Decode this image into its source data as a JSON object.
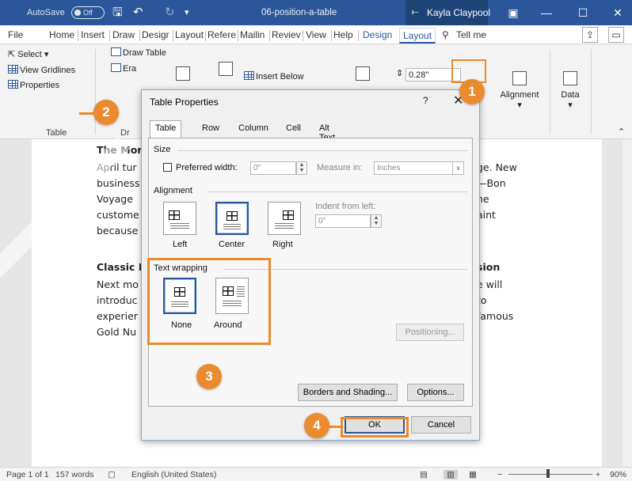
{
  "titlebar": {
    "autosave_label": "AutoSave",
    "autosave_state": "Off",
    "save_icon": "save-icon",
    "undo_icon": "undo-icon",
    "redo_icon": "redo-icon",
    "customize_icon": "customize-icon",
    "filename": "06-position-a-table",
    "user_name": "Kayla Claypool",
    "user_icon_glyph": "⟝",
    "ribbon_display_glyph": "▣",
    "minimize_glyph": "—",
    "maximize_glyph": "☐",
    "close_glyph": "✕"
  },
  "tabs": [
    {
      "label": "File"
    },
    {
      "label": "Home"
    },
    {
      "label": "Insert"
    },
    {
      "label": "Draw"
    },
    {
      "label": "Desigr"
    },
    {
      "label": "Layout"
    },
    {
      "label": "Refere"
    },
    {
      "label": "Mailin"
    },
    {
      "label": "Reviev"
    },
    {
      "label": "View"
    },
    {
      "label": "Help"
    },
    {
      "label": "Design"
    },
    {
      "label": "Layout"
    },
    {
      "label": "Tell me"
    }
  ],
  "ribbon": {
    "select_label": "Select",
    "view_gridlines_label": "View Gridlines",
    "properties_label": "Properties",
    "table_group_label": "Table",
    "draw_table_label": "Draw Table",
    "eraser_label": "Era",
    "draw_group_label": "Dr",
    "insert_below_label": "Insert Below",
    "height_value": "0.28\"",
    "alignment_label": "Alignment",
    "data_label": "Data"
  },
  "document": {
    "lines": [
      {
        "left": "The Mor",
        "right": ""
      },
      {
        "left": "April tur",
        "right": "ge. New"
      },
      {
        "left": "business",
        "right": "—Bon"
      },
      {
        "left": "Voyage",
        "right": "ne"
      },
      {
        "left": "custome",
        "right": "aint"
      },
      {
        "left": "because",
        "right": ""
      },
      {
        "left": "Classic L",
        "right": "sion"
      },
      {
        "left": "Next mo",
        "right": "e will"
      },
      {
        "left": "introduc",
        "right": "to"
      },
      {
        "left": "experier",
        "right": "famous"
      },
      {
        "left": "Gold Nu",
        "right": ""
      }
    ]
  },
  "dialog": {
    "title": "Table Properties",
    "help_glyph": "?",
    "close_glyph": "✕",
    "tabs": [
      "Table",
      "Row",
      "Column",
      "Cell",
      "Alt Text"
    ],
    "size_label": "Size",
    "preferred_width_label": "Preferred width:",
    "preferred_width_value": "0\"",
    "measure_in_label": "Measure in:",
    "measure_in_value": "Inches",
    "alignment_label": "Alignment",
    "align_left": "Left",
    "align_center": "Center",
    "align_right": "Right",
    "indent_label": "Indent from left:",
    "indent_value": "0\"",
    "text_wrapping_label": "Text wrapping",
    "wrap_none": "None",
    "wrap_around": "Around",
    "positioning_btn": "Positioning...",
    "borders_btn": "Borders and Shading...",
    "options_btn": "Options...",
    "ok_btn": "OK",
    "cancel_btn": "Cancel"
  },
  "statusbar": {
    "page": "Page 1 of 1",
    "words": "157 words",
    "language": "English (United States)",
    "zoom": "90%",
    "zoom_minus": "−",
    "zoom_plus": "+"
  },
  "callouts": [
    "1",
    "2",
    "3",
    "4"
  ],
  "colors": {
    "titlebar": "#2b579a",
    "accent": "#2b579a",
    "callout": "#ea8b2f"
  }
}
